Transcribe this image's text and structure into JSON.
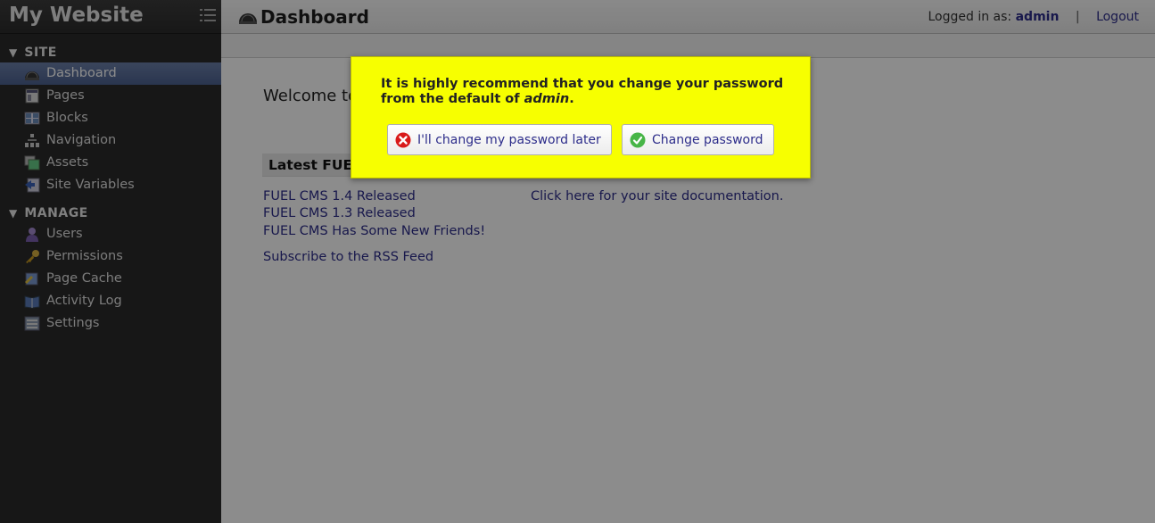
{
  "sidebar": {
    "site_title": "My Website",
    "sections": {
      "site": {
        "label": "SITE",
        "items": [
          {
            "label": "Dashboard"
          },
          {
            "label": "Pages"
          },
          {
            "label": "Blocks"
          },
          {
            "label": "Navigation"
          },
          {
            "label": "Assets"
          },
          {
            "label": "Site Variables"
          }
        ]
      },
      "manage": {
        "label": "MANAGE",
        "items": [
          {
            "label": "Users"
          },
          {
            "label": "Permissions"
          },
          {
            "label": "Page Cache"
          },
          {
            "label": "Activity Log"
          },
          {
            "label": "Settings"
          }
        ]
      }
    }
  },
  "header": {
    "title": "Dashboard",
    "logged_in_prefix": "Logged in as:",
    "username": "admin",
    "separator": "|",
    "logout_label": "Logout"
  },
  "main": {
    "welcome": "Welcome to",
    "latest_header": "Latest FUEL",
    "news": [
      {
        "label": "FUEL CMS 1.4 Released"
      },
      {
        "label": "FUEL CMS 1.3 Released"
      },
      {
        "label": "FUEL CMS Has Some New Friends!"
      }
    ],
    "rss_label": "Subscribe to the RSS Feed",
    "doc_link": "Click here for your site documentation."
  },
  "modal": {
    "msg_line1": "It is highly recommend that you change your password",
    "msg_line2_prefix": "from the default of",
    "msg_default_pw": "admin",
    "msg_line2_suffix": ".",
    "later_label": "I'll change my password later",
    "change_label": "Change password"
  },
  "colors": {
    "modal_bg": "#f7ff00",
    "link": "#2c2c8a",
    "sidebar_bg": "#2a2a2a",
    "active_item": "#5a6e9c"
  }
}
